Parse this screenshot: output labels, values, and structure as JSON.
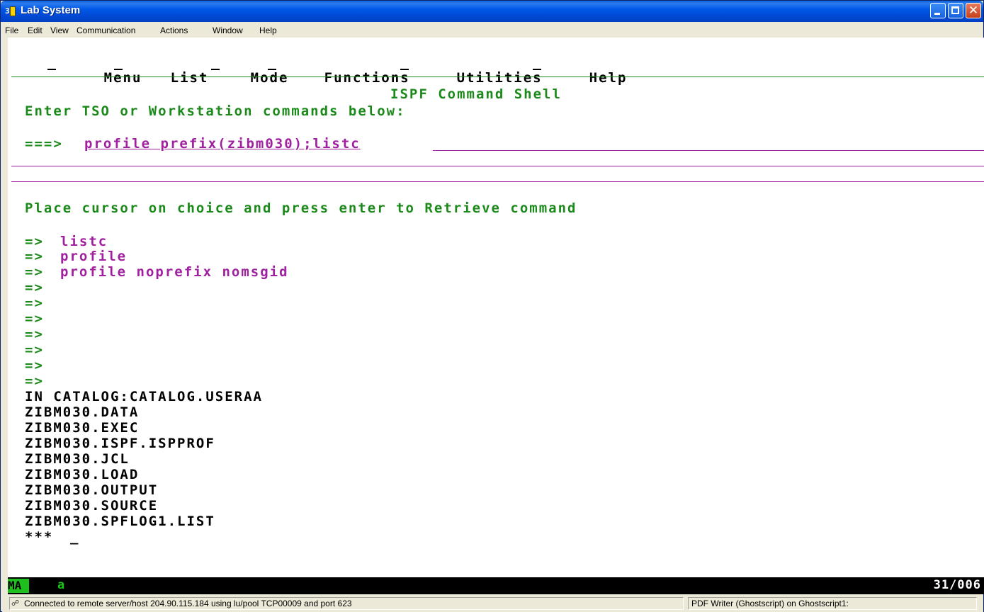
{
  "window": {
    "title": "Lab System",
    "icon": "pcomm-session-icon"
  },
  "menubar": {
    "items": [
      "File",
      "Edit",
      "View",
      "Communication",
      "Actions",
      "Window",
      "Help"
    ]
  },
  "ispf": {
    "action_bar": [
      "Menu",
      "List",
      "Mode",
      "Functions",
      "Utilities",
      "Help"
    ],
    "panel_title": "ISPF Command Shell",
    "instructions": "Enter TSO or Workstation commands below:",
    "command_prompt": "===>",
    "command_value": "profile prefix(zibm030);listc",
    "retrieve_instructions": "Place cursor on choice and press enter to Retrieve command",
    "retrieve_prompt": "=>",
    "retrieve_list": [
      "listc",
      "profile",
      "profile noprefix nomsgid",
      "",
      "",
      "",
      "",
      "",
      "",
      ""
    ],
    "output_lines": [
      "IN CATALOG:CATALOG.USERAA",
      "ZIBM030.DATA",
      "ZIBM030.EXEC",
      "ZIBM030.ISPF.ISPPROF",
      "ZIBM030.JCL",
      "ZIBM030.LOAD",
      "ZIBM030.OUTPUT",
      "ZIBM030.SOURCE",
      "ZIBM030.SPFLOG1.LIST"
    ],
    "end_marker": "***",
    "cursor": "_"
  },
  "oia": {
    "indicator": "MA",
    "input_mode": "a",
    "cursor_position": "31/006"
  },
  "statusbar": {
    "connection": "Connected to remote server/host 204.90.115.184 using lu/pool TCP00009 and port 623",
    "printer": "PDF Writer (Ghostscript) on Ghostscript1:"
  },
  "colors": {
    "green_text": "#1b8a1b",
    "magenta_text": "#a020a0",
    "title_bar": "#0058e6",
    "oia_green": "#1ec01e"
  }
}
